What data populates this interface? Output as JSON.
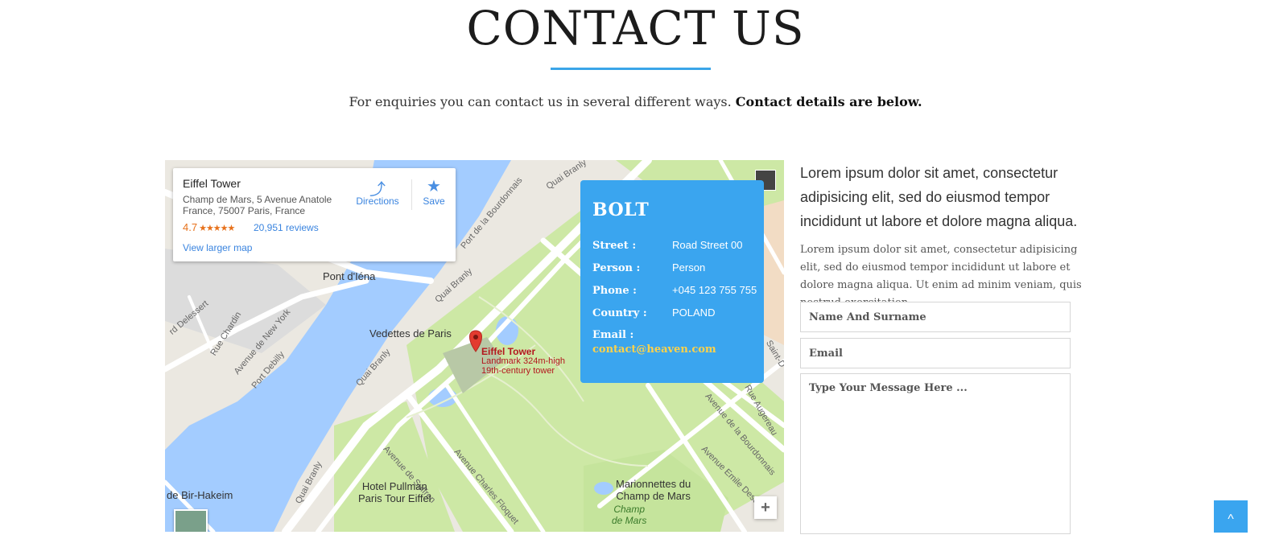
{
  "page": {
    "heading": "CONTACT US",
    "intro_text": "For enquiries you can contact us in several different ways.",
    "intro_bold": "Contact details are below."
  },
  "map": {
    "place_card": {
      "title": "Eiffel Tower",
      "address": "Champ de Mars, 5 Avenue Anatole France, 75007 Paris, France",
      "rating": "4.7",
      "stars": "★★★★★",
      "reviews": "20,951 reviews",
      "larger_map": "View larger map",
      "directions_label": "Directions",
      "save_label": "Save",
      "directions_icon": "directions-icon",
      "save_icon": "star-icon"
    },
    "labels": {
      "pont_iena": "Pont d'Iéna",
      "vedettes": "Vedettes de Paris",
      "quai_branly_1": "Quai Branly",
      "quai_branly_2": "Quai Branly",
      "quai_branly_3": "Quai Branly",
      "quai_branly_4": "Quai Branly",
      "port_bourdonnais": "Port de la Bourdonnais",
      "av_new_york": "Avenue de New York",
      "port_debilly": "Port Debilly",
      "rue_chardin": "Rue Chardin",
      "rd_delessert": "rd Delessert",
      "av_suffren": "Avenue de Suffren",
      "av_charles_floquet": "Avenue Charles Floquet",
      "av_bourdonnais": "Avenue de la Bourdonnais",
      "av_emile_deschanel": "Avenue Emile Deschanel",
      "rue_augereau": "Rue Augereau",
      "hotel_pullman_1": "Hotel Pullman",
      "hotel_pullman_2": "Paris Tour Eiffel",
      "marionnettes_1": "Marionnettes du",
      "marionnettes_2": "Champ de Mars",
      "champ_de_mars_1": "Champ",
      "champ_de_mars_2": "de Mars",
      "bir_hakeim": "de Bir-Hakeim",
      "saint_d": "Saint-D",
      "poi_title": "Eiffel Tower",
      "poi_sub1": "Landmark 324m-high",
      "poi_sub2": "19th-century tower"
    },
    "zoom_in": "+"
  },
  "bolt_card": {
    "title": "BOLT",
    "rows": [
      {
        "key": "Street :",
        "value": "Road Street 00"
      },
      {
        "key": "Person :",
        "value": "Person"
      },
      {
        "key": "Phone :",
        "value": "+045 123 755 755"
      },
      {
        "key": "Country :",
        "value": "POLAND"
      }
    ],
    "email_key": "Email :",
    "email_value": "contact@heaven.com"
  },
  "sidebar": {
    "title": "Lorem ipsum dolor sit amet, consectetur adipisicing elit, sed do eiusmod tempor incididunt ut labore et dolore magna aliqua.",
    "text": "Lorem ipsum dolor sit amet, consectetur adipisicing elit, sed do eiusmod tempor incididunt ut labore et dolore magna aliqua. Ut enim ad minim veniam, quis nostrud exercitation."
  },
  "form": {
    "name_placeholder": "Name And Surname",
    "email_placeholder": "Email",
    "message_placeholder": "Type Your Message Here ..."
  },
  "scroll_top": {
    "icon": "chevron-up-icon",
    "glyph": "^"
  },
  "colors": {
    "accent": "#3aa5ef",
    "email": "#ffd24a",
    "water": "#a3ccff",
    "park": "#cde8a5"
  }
}
